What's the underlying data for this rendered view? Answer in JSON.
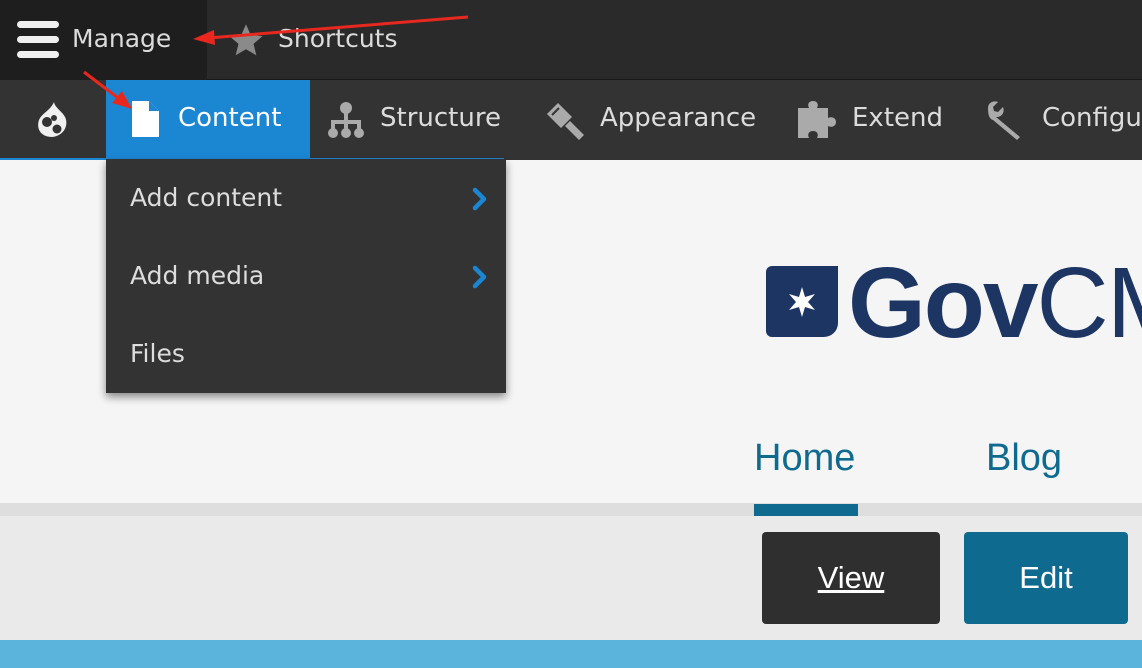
{
  "toolbar": {
    "manage_label": "Manage",
    "shortcuts_label": "Shortcuts"
  },
  "tray": {
    "items": [
      {
        "label": "Content",
        "icon": "document-icon",
        "active": true
      },
      {
        "label": "Structure",
        "icon": "sitemap-icon"
      },
      {
        "label": "Appearance",
        "icon": "paintbrush-icon"
      },
      {
        "label": "Extend",
        "icon": "puzzle-icon"
      },
      {
        "label": "Configur",
        "icon": "wrench-icon"
      }
    ]
  },
  "dropdown": {
    "items": [
      {
        "label": "Add content",
        "has_submenu": true
      },
      {
        "label": "Add media",
        "has_submenu": true
      },
      {
        "label": "Files",
        "has_submenu": false
      }
    ]
  },
  "site": {
    "logo_text_bold": "Gov",
    "logo_text_regular": "CM"
  },
  "nav": {
    "home": "Home",
    "blog": "Blog"
  },
  "tasks": {
    "view": "View",
    "edit": "Edit"
  },
  "colors": {
    "toolbar_bg": "#2a2a2a",
    "tray_bg": "#333333",
    "active_tab": "#1b87d3",
    "brand_navy": "#1d3563",
    "link_teal": "#0f6a8f",
    "annotation_arrow": "#e8281e"
  }
}
